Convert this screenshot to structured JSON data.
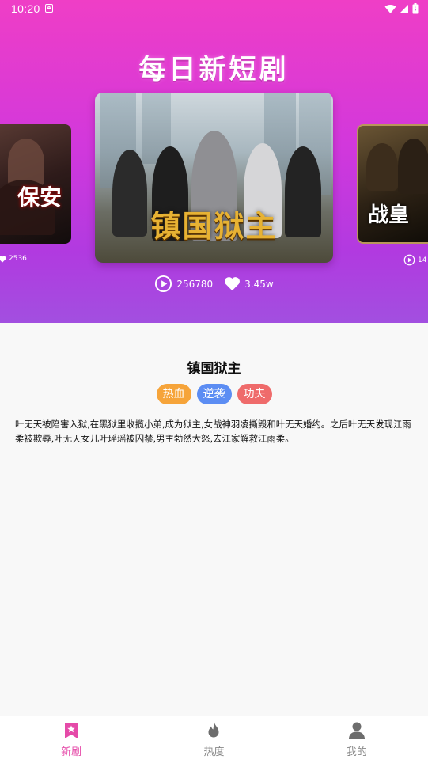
{
  "status_bar": {
    "time": "10:20",
    "notification_glyph": "A"
  },
  "hero": {
    "title": "每日新短剧",
    "cards": [
      {
        "poster_text": "保安",
        "like_count": "2536"
      },
      {
        "poster_text": "镇国狱主"
      },
      {
        "poster_text": "战皇",
        "play_count": "14"
      }
    ],
    "play_count": "256780",
    "like_count": "3.45w"
  },
  "drama": {
    "title": "镇国狱主",
    "tags": [
      {
        "label": "热血",
        "color": "#f6a43a"
      },
      {
        "label": "逆袭",
        "color": "#5c8df3"
      },
      {
        "label": "功夫",
        "color": "#ef6b6b"
      }
    ],
    "description": "叶无天被陷害入狱,在黑狱里收揽小弟,成为狱主,女战神羽凌撕毁和叶无天婚约。之后叶无天发现江雨柔被欺辱,叶无天女儿叶瑶瑶被囚禁,男主勃然大怒,去江家解救江雨柔。"
  },
  "bottom_nav": {
    "items": [
      {
        "label": "新剧",
        "icon": "star-bookmark-icon",
        "active": true
      },
      {
        "label": "热度",
        "icon": "flame-icon",
        "active": false
      },
      {
        "label": "我的",
        "icon": "person-icon",
        "active": false
      }
    ],
    "active_color": "#e54aa8",
    "inactive_color": "#888888"
  }
}
